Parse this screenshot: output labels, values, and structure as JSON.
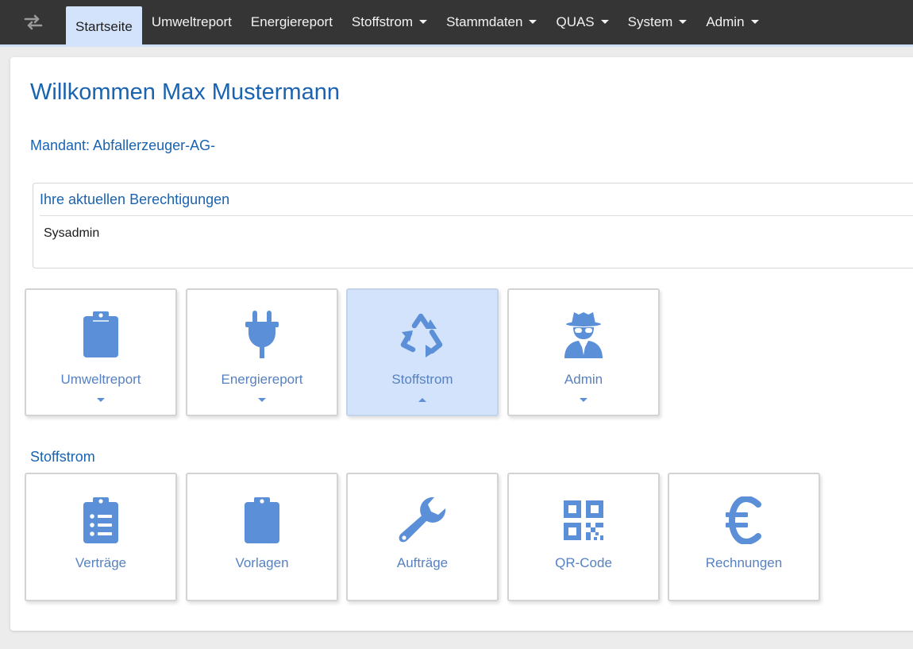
{
  "navbar": {
    "toggle_icon": "exchange-arrows-icon",
    "items": [
      {
        "label": "Startseite",
        "active": true,
        "dropdown": false
      },
      {
        "label": "Umweltreport",
        "active": false,
        "dropdown": false
      },
      {
        "label": "Energiereport",
        "active": false,
        "dropdown": false
      },
      {
        "label": "Stoffstrom",
        "active": false,
        "dropdown": true
      },
      {
        "label": "Stammdaten",
        "active": false,
        "dropdown": true
      },
      {
        "label": "QUAS",
        "active": false,
        "dropdown": true
      },
      {
        "label": "System",
        "active": false,
        "dropdown": true
      },
      {
        "label": "Admin",
        "active": false,
        "dropdown": true
      }
    ]
  },
  "main": {
    "welcome": "Willkommen Max Mustermann",
    "mandant": "Mandant: Abfallerzeuger-AG-",
    "permissions": {
      "title": "Ihre aktuellen Berechtigungen",
      "value": "Sysadmin"
    },
    "tiles": [
      {
        "label": "Umweltreport",
        "icon": "clipboard-icon",
        "expanded": false
      },
      {
        "label": "Energiereport",
        "icon": "plug-icon",
        "expanded": false
      },
      {
        "label": "Stoffstrom",
        "icon": "recycle-icon",
        "expanded": true
      },
      {
        "label": "Admin",
        "icon": "user-secret-icon",
        "expanded": false
      }
    ],
    "section": {
      "title": "Stoffstrom",
      "tiles": [
        {
          "label": "Verträge",
          "icon": "clipboard-list-icon"
        },
        {
          "label": "Vorlagen",
          "icon": "clipboard-icon"
        },
        {
          "label": "Aufträge",
          "icon": "wrench-icon"
        },
        {
          "label": "QR-Code",
          "icon": "qrcode-icon"
        },
        {
          "label": "Rechnungen",
          "icon": "euro-icon"
        }
      ]
    }
  },
  "colors": {
    "navbar_bg": "#353535",
    "active_bg": "#d2e3fb",
    "heading_blue": "#1a63b0",
    "icon_blue": "#5b8fd8",
    "tile_label": "#5781c0"
  }
}
